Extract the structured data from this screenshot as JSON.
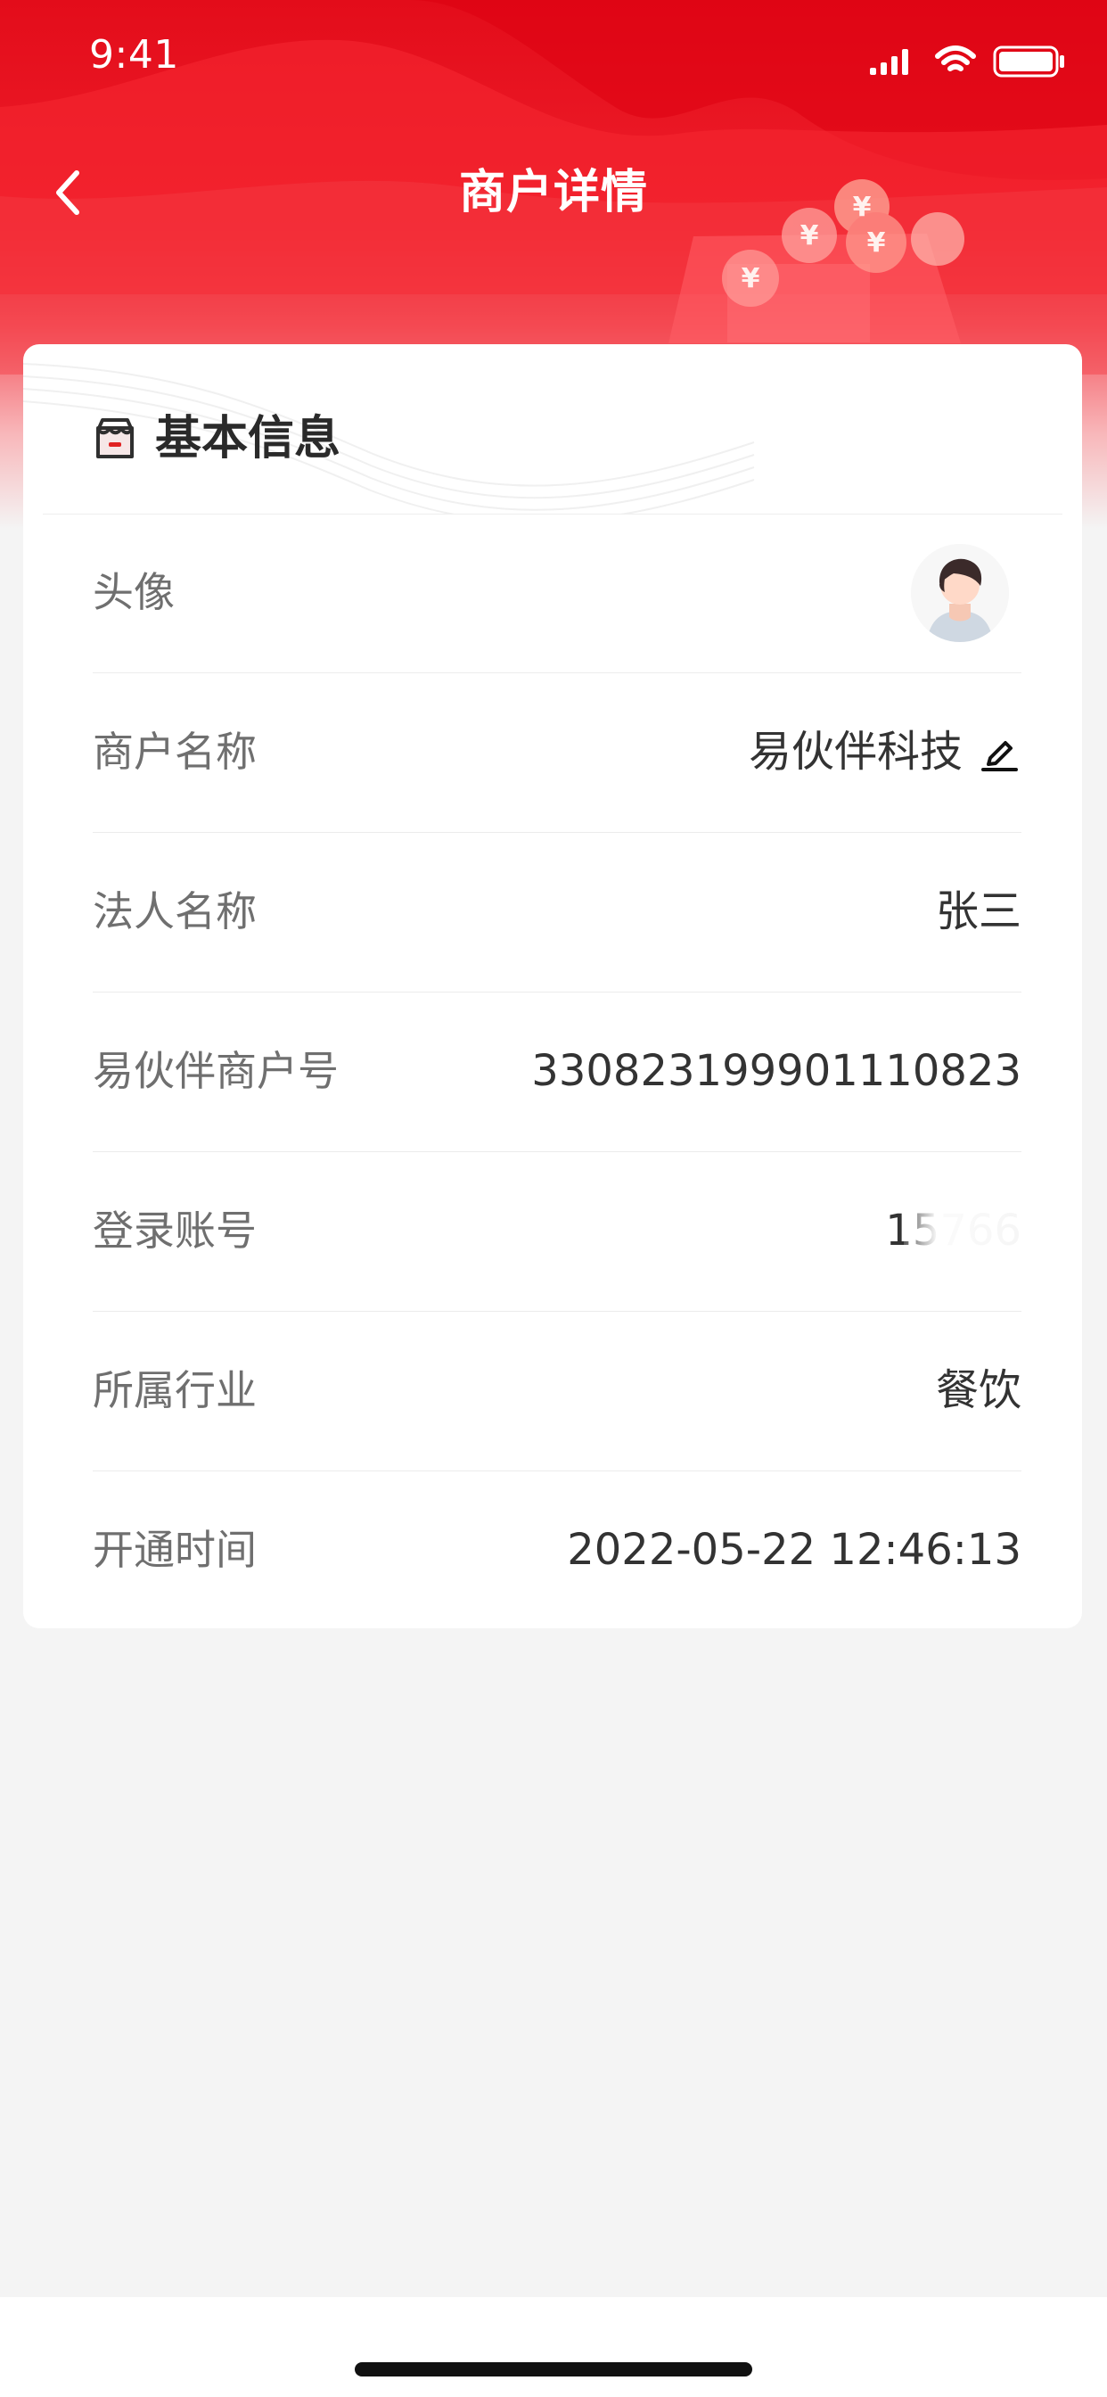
{
  "status_bar": {
    "time": "9:41"
  },
  "header": {
    "title": "商户详情"
  },
  "section": {
    "title": "基本信息"
  },
  "details": {
    "avatar_label": "头像",
    "merchant_name_label": "商户名称",
    "merchant_name_value": "易伙伴科技",
    "legal_person_label": "法人名称",
    "legal_person_value": "张三",
    "merchant_no_label": "易伙伴商户号",
    "merchant_no_value": "330823199901110823",
    "login_account_label": "登录账号",
    "login_account_value": "15766",
    "industry_label": "所属行业",
    "industry_value": "餐饮",
    "open_time_label": "开通时间",
    "open_time_value": "2022-05-22 12:46:13"
  },
  "icons": {
    "back": "chevron-left-icon",
    "section": "store-icon",
    "edit": "pencil-icon",
    "signal": "signal-icon",
    "wifi": "wifi-icon",
    "battery": "battery-icon",
    "avatar": "avatar-icon"
  },
  "colors": {
    "brand_red": "#e30c1a",
    "text_primary": "#333333",
    "text_secondary": "#6f6f6f",
    "background": "#f4f4f4",
    "card": "#ffffff"
  }
}
